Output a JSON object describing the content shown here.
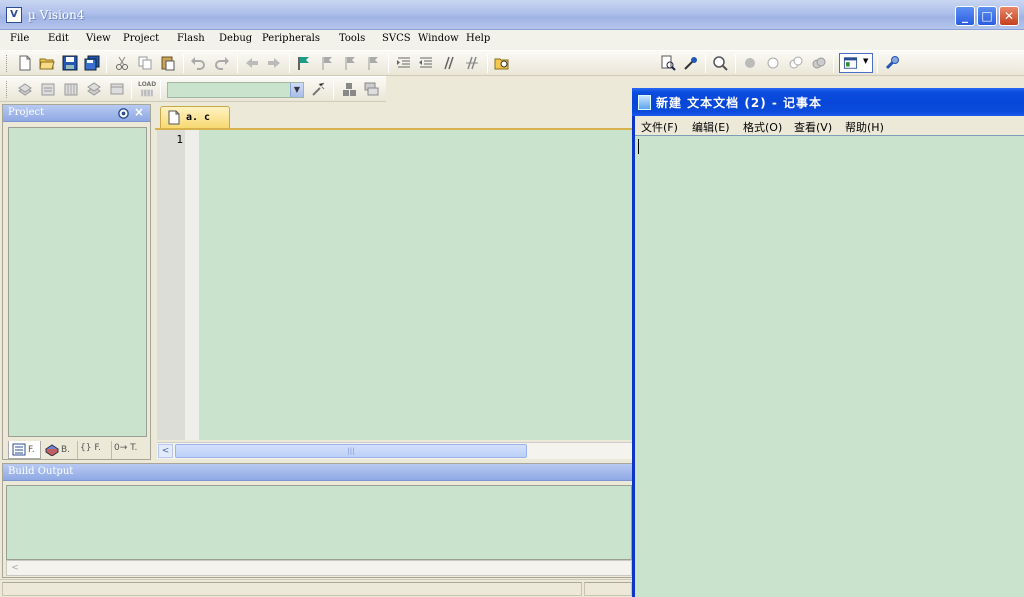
{
  "app": {
    "title": "µ Vision4",
    "icon_glyph": "V"
  },
  "window_controls": {
    "minimize": "_",
    "maximize": "□",
    "close": "✕"
  },
  "menu": [
    "File",
    "Edit",
    "View",
    "Project",
    "Flash",
    "Debug",
    "Peripherals",
    "Tools",
    "SVCS",
    "Window",
    "Help"
  ],
  "toolbar2": {
    "load_label": "LOAD"
  },
  "project_panel": {
    "title": "Project",
    "tabs": [
      "F.",
      "B.",
      "{} F.",
      "0→ T."
    ]
  },
  "editor": {
    "tab_label": "a. c",
    "line_numbers": [
      "1"
    ],
    "scroll_left": "<",
    "scroll_grip": "|||"
  },
  "build_output": {
    "title": "Build Output",
    "scroll_left": "<"
  },
  "notepad": {
    "title": "新建 文本文档 (2) - 记事本",
    "menu": [
      "文件(F)",
      "编辑(E)",
      "格式(O)",
      "查看(V)",
      "帮助(H)"
    ],
    "content": ""
  },
  "colors": {
    "editor_bg": "#c9e3cc",
    "xp_blue": "#0846d8",
    "tab_accent": "#f7d870"
  }
}
